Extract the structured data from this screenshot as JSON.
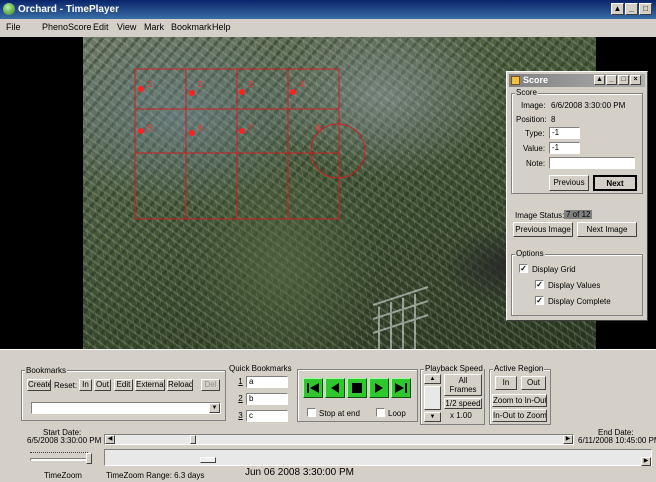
{
  "window": {
    "title": "Orchard - TimePlayer"
  },
  "menu": [
    "File",
    "PhenoScore",
    "Edit",
    "View",
    "Mark",
    "Bookmark",
    "Help"
  ],
  "grid": {
    "labels": [
      "1",
      "2",
      "3",
      "4",
      "5",
      "6",
      "7",
      "8"
    ]
  },
  "score": {
    "title": "Score",
    "group_label": "Score",
    "image_label": "Image:",
    "image_value": "6/6/2008 3:30:00 PM",
    "position_label": "Position:",
    "position_value": "8",
    "type_label": "Type:",
    "type_value": "-1",
    "value_label": "Value:",
    "value_value": "-1",
    "note_label": "Note:",
    "note_value": "",
    "previous_label": "Previous",
    "next_label": "Next",
    "image_status_label": "Image Status:",
    "image_status_value": "7 of 12",
    "previous_image_label": "Previous Image",
    "next_image_label": "Next Image",
    "options_label": "Options",
    "display_grid_label": "Display Grid",
    "display_values_label": "Display Values",
    "display_complete_label": "Display Complete",
    "display_grid_checked": true,
    "display_values_checked": true,
    "display_complete_checked": true
  },
  "bookmarks": {
    "group_label": "Bookmarks",
    "create_label": "Create",
    "reset_label": "Reset:",
    "in_label": "In",
    "out_label": "Out",
    "edit_label": "Edit",
    "external_label": "External",
    "reload_label": "Reload",
    "del_label": "Del",
    "selected": ""
  },
  "quick_bookmarks": {
    "group_label": "Quick Bookmarks",
    "items": [
      {
        "number": "1",
        "value": "a"
      },
      {
        "number": "2",
        "value": "b"
      },
      {
        "number": "3",
        "value": "c"
      }
    ]
  },
  "transport": {
    "stop_at_end_label": "Stop at end",
    "loop_label": "Loop",
    "stop_at_end_checked": false,
    "loop_checked": false
  },
  "playback_speed": {
    "group_label": "Playback Speed",
    "all_frames_label": "All Frames",
    "half_speed_label": "1/2 speed",
    "speed_value": "x 1.00"
  },
  "active_region": {
    "group_label": "Active Region",
    "in_label": "In",
    "out_label": "Out",
    "zoom_to_in_out_label": "Zoom to In-Out",
    "in_out_to_zoom_label": "In-Out to Zoom"
  },
  "timeline": {
    "start_date_label": "Start Date:",
    "start_date_value": "6/5/2008 3:30:00 PM",
    "end_date_label": "End Date:",
    "end_date_value": "6/11/2008 10:45:00 PM",
    "timezoom_label": "TimeZoom",
    "timezoom_range_label": "TimeZoom Range: 6.3 days",
    "current_time": "Jun 06 2008 3:30:00 PM",
    "position_fraction": 0.17
  },
  "colors": {
    "title_bar": "#0a246a",
    "grid_line": "#cc2020",
    "nav_button": "#2ec82e"
  }
}
